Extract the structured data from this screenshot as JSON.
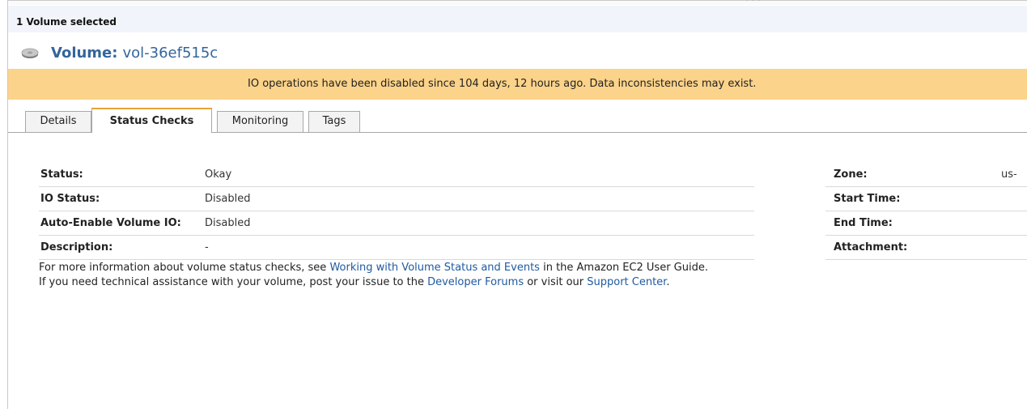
{
  "grip": {
    "dots": "' ' '"
  },
  "selection": {
    "label": "1 Volume selected"
  },
  "volume": {
    "title_label": "Volume:",
    "id": "vol-36ef515c",
    "icon": "disk-icon"
  },
  "warning": {
    "text": "IO operations have been disabled since 104 days, 12 hours ago. Data inconsistencies may exist.",
    "color": "#fbd38a"
  },
  "tabs": [
    {
      "label": "Details"
    },
    {
      "label": "Status Checks",
      "active": true
    },
    {
      "label": "Monitoring"
    },
    {
      "label": "Tags"
    }
  ],
  "status_fields": [
    {
      "key": "Status:",
      "value": "Okay"
    },
    {
      "key": "IO Status:",
      "value": "Disabled"
    },
    {
      "key": "Auto-Enable Volume IO:",
      "value": "Disabled"
    },
    {
      "key": "Description:",
      "value": "-"
    }
  ],
  "right_fields": [
    {
      "key": "Zone:",
      "value": "us-"
    },
    {
      "key": "Start Time:",
      "value": ""
    },
    {
      "key": "End Time:",
      "value": ""
    },
    {
      "key": "Attachment:",
      "value": ""
    }
  ],
  "info": {
    "line1_pre": "For more information about volume status checks, see ",
    "line1_link": "Working with Volume Status and Events",
    "line1_post": " in the Amazon EC2 User Guide.",
    "line2_pre": "If you need technical assistance with your volume, post your issue to the ",
    "line2_link1": "Developer Forums",
    "line2_mid": " or visit our ",
    "line2_link2": "Support Center",
    "line2_post": "."
  },
  "colors": {
    "accent_link": "#1f5aa0",
    "title": "#34659c",
    "active_tab_border": "#e9a33a"
  }
}
